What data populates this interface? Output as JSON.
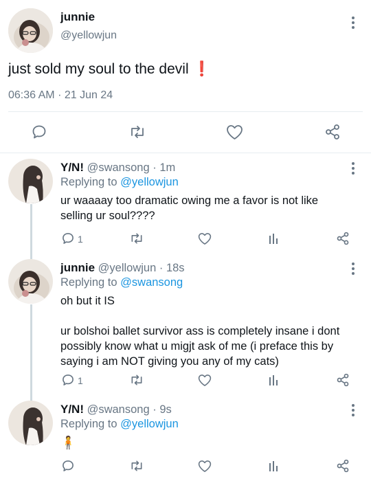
{
  "main_tweet": {
    "display_name": "junnie",
    "handle": "@yellowjun",
    "text": "just sold my soul to the devil",
    "emoji": "❗",
    "time": "06:36 AM",
    "separator": "·",
    "date": "21 Jun 24"
  },
  "replies": [
    {
      "display_name": "Y/N!",
      "handle": "@swansong",
      "age": "· 1m",
      "replying_prefix": "Replying to",
      "replying_handle": "@yellowjun",
      "lines": [
        "ur waaaay too dramatic owing me a favor is not like",
        "selling ur soul????"
      ],
      "reply_count": "1"
    },
    {
      "display_name": "junnie",
      "handle": "@yellowjun",
      "age": "· 18s",
      "replying_prefix": "Replying to",
      "replying_handle": "@swansong",
      "lines": [
        "oh but it IS",
        "",
        "ur bolshoi ballet survivor ass is completely insane i dont",
        "possibly know what u migjt ask of me (i preface this by",
        "saying i am NOT giving you any of my cats)"
      ],
      "reply_count": "1"
    },
    {
      "display_name": "Y/N!",
      "handle": "@swansong",
      "age": "· 9s",
      "replying_prefix": "Replying to",
      "replying_handle": "@yellowjun",
      "lines": [
        "🧍"
      ],
      "reply_count": ""
    }
  ],
  "icons": [
    "reply-icon",
    "retweet-icon",
    "like-icon",
    "analytics-icon",
    "share-icon",
    "more-icon"
  ],
  "colors": {
    "link": "#1b95e0",
    "muted": "#687684",
    "text": "#0f1419",
    "emoji_red": "#e0245e"
  }
}
